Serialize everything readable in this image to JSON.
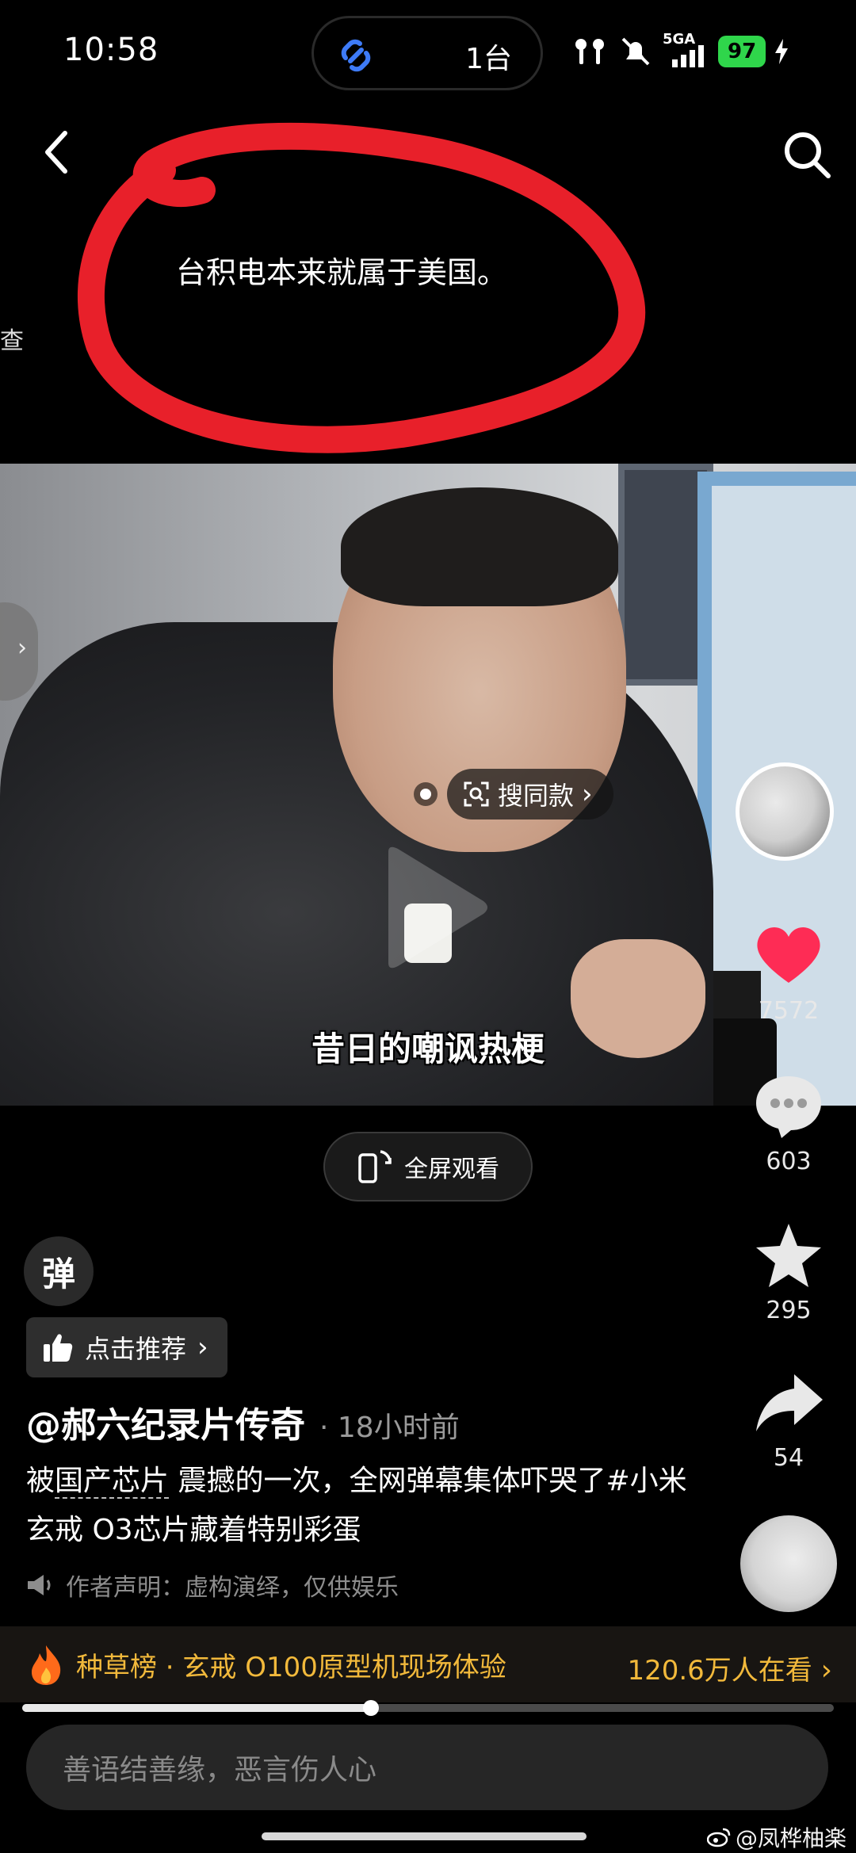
{
  "status_bar": {
    "time": "10:58",
    "island_text": "1台",
    "network": "5GA",
    "battery": "97"
  },
  "annotation": {
    "quote": "台积电本来就属于美国。",
    "side_glyph": "查",
    "highlight_color": "#e8202a"
  },
  "video": {
    "search_same": "搜同款",
    "subtitle": "昔日的嘲讽热梗"
  },
  "actions": {
    "likes": "7572",
    "comments": "603",
    "favorites": "295",
    "shares": "54",
    "like_color": "#fe2c55"
  },
  "fullscreen_label": "全屏观看",
  "danmaku_label": "弹",
  "recommend_label": "点击推荐",
  "post": {
    "author": "@郝六纪录片传奇",
    "time": "· 18小时前",
    "desc_prefix": "被",
    "desc_keyword": "国产芯片",
    "desc_rest": " 震撼的一次，全网弹幕集体吓哭了#小米玄戒 O3芯片藏着特别彩蛋",
    "notice": "作者声明：虚构演绎，仅供娱乐"
  },
  "rank_bar": {
    "title": "种草榜 · 玄戒 O100原型机现场体验",
    "live": "120.6万人在看",
    "accent": "#f2b93b"
  },
  "progress": 0.43,
  "comment_placeholder": "善语结善缘，恶言伤人心",
  "watermark": "@凤桦柚楽"
}
